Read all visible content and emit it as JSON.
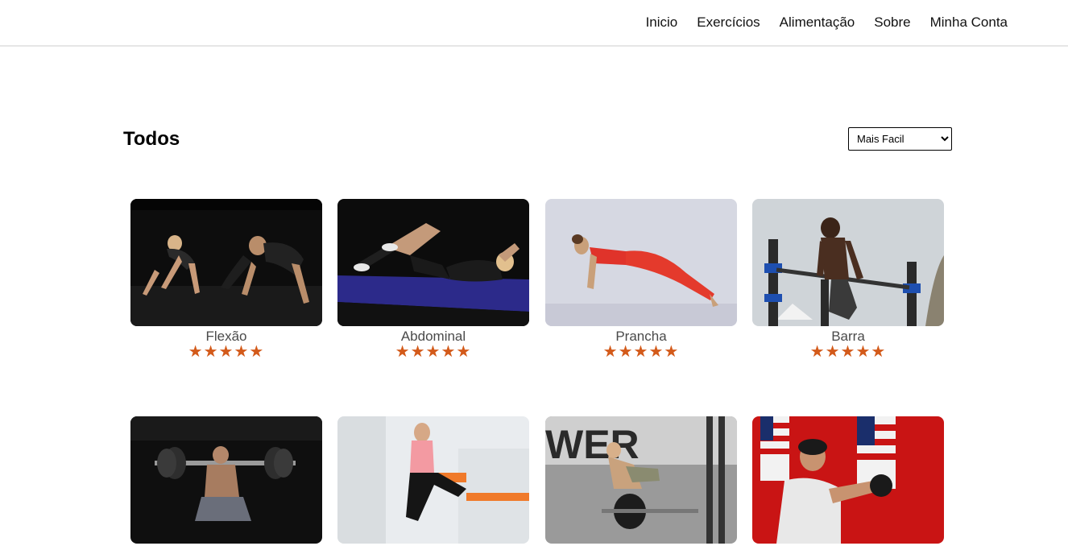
{
  "nav": {
    "items": [
      {
        "label": "Inicio"
      },
      {
        "label": "Exercícios"
      },
      {
        "label": "Alimentação"
      },
      {
        "label": "Sobre"
      },
      {
        "label": "Minha Conta"
      }
    ]
  },
  "section": {
    "title": "Todos"
  },
  "sort": {
    "selected": "Mais Facil"
  },
  "cards": [
    {
      "title": "Flexão",
      "rating": 5
    },
    {
      "title": "Abdominal",
      "rating": 5
    },
    {
      "title": "Prancha",
      "rating": 5
    },
    {
      "title": "Barra",
      "rating": 5
    },
    {
      "title": "",
      "rating": 0
    },
    {
      "title": "",
      "rating": 0
    },
    {
      "title": "",
      "rating": 0
    },
    {
      "title": "",
      "rating": 0
    }
  ],
  "colors": {
    "star": "#d35a1a",
    "divider": "#e6e6e6"
  }
}
